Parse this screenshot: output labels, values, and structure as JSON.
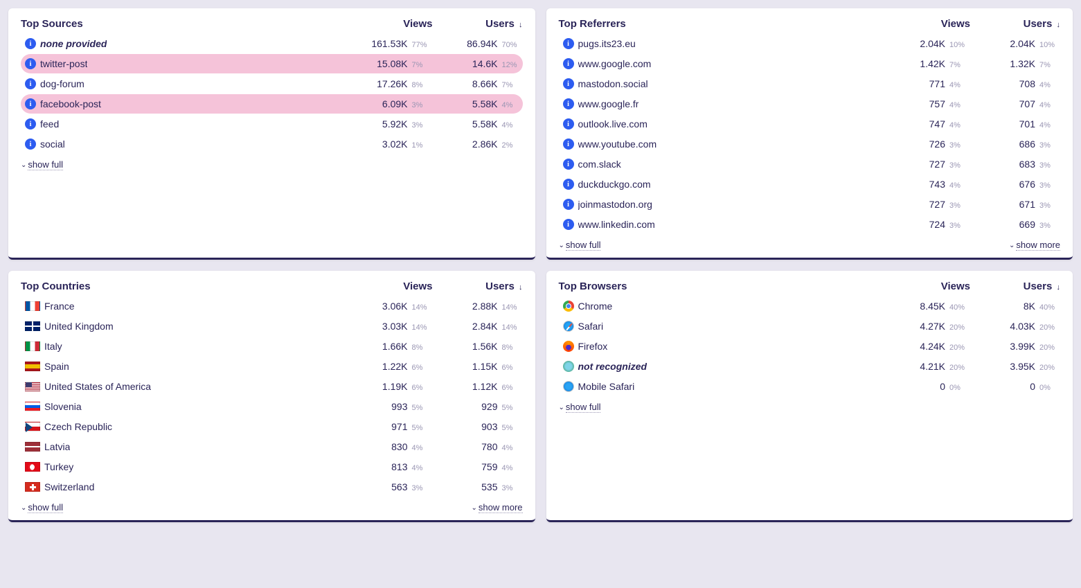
{
  "headers": {
    "views": "Views",
    "users": "Users",
    "sortIndicator": "↓"
  },
  "footer": {
    "showFull": "show full",
    "showMore": "show more"
  },
  "panels": {
    "sources": {
      "title": "Top Sources",
      "showMore": false,
      "rows": [
        {
          "label": "none provided",
          "italic": true,
          "highlight": false,
          "views": "161.53K",
          "viewsPct": "77%",
          "users": "86.94K",
          "usersPct": "70%"
        },
        {
          "label": "twitter-post",
          "italic": false,
          "highlight": true,
          "views": "15.08K",
          "viewsPct": "7%",
          "users": "14.6K",
          "usersPct": "12%"
        },
        {
          "label": "dog-forum",
          "italic": false,
          "highlight": false,
          "views": "17.26K",
          "viewsPct": "8%",
          "users": "8.66K",
          "usersPct": "7%"
        },
        {
          "label": "facebook-post",
          "italic": false,
          "highlight": true,
          "views": "6.09K",
          "viewsPct": "3%",
          "users": "5.58K",
          "usersPct": "4%"
        },
        {
          "label": "feed",
          "italic": false,
          "highlight": false,
          "views": "5.92K",
          "viewsPct": "3%",
          "users": "5.58K",
          "usersPct": "4%"
        },
        {
          "label": "social",
          "italic": false,
          "highlight": false,
          "views": "3.02K",
          "viewsPct": "1%",
          "users": "2.86K",
          "usersPct": "2%"
        }
      ]
    },
    "referrers": {
      "title": "Top Referrers",
      "showMore": true,
      "rows": [
        {
          "label": "pugs.its23.eu",
          "views": "2.04K",
          "viewsPct": "10%",
          "users": "2.04K",
          "usersPct": "10%"
        },
        {
          "label": "www.google.com",
          "views": "1.42K",
          "viewsPct": "7%",
          "users": "1.32K",
          "usersPct": "7%"
        },
        {
          "label": "mastodon.social",
          "views": "771",
          "viewsPct": "4%",
          "users": "708",
          "usersPct": "4%"
        },
        {
          "label": "www.google.fr",
          "views": "757",
          "viewsPct": "4%",
          "users": "707",
          "usersPct": "4%"
        },
        {
          "label": "outlook.live.com",
          "views": "747",
          "viewsPct": "4%",
          "users": "701",
          "usersPct": "4%"
        },
        {
          "label": "www.youtube.com",
          "views": "726",
          "viewsPct": "3%",
          "users": "686",
          "usersPct": "3%"
        },
        {
          "label": "com.slack",
          "views": "727",
          "viewsPct": "3%",
          "users": "683",
          "usersPct": "3%"
        },
        {
          "label": "duckduckgo.com",
          "views": "743",
          "viewsPct": "4%",
          "users": "676",
          "usersPct": "3%"
        },
        {
          "label": "joinmastodon.org",
          "views": "727",
          "viewsPct": "3%",
          "users": "671",
          "usersPct": "3%"
        },
        {
          "label": "www.linkedin.com",
          "views": "724",
          "viewsPct": "3%",
          "users": "669",
          "usersPct": "3%"
        }
      ]
    },
    "countries": {
      "title": "Top Countries",
      "showMore": true,
      "rows": [
        {
          "label": "France",
          "flag": "fr",
          "views": "3.06K",
          "viewsPct": "14%",
          "users": "2.88K",
          "usersPct": "14%"
        },
        {
          "label": "United Kingdom",
          "flag": "gb",
          "views": "3.03K",
          "viewsPct": "14%",
          "users": "2.84K",
          "usersPct": "14%"
        },
        {
          "label": "Italy",
          "flag": "it",
          "views": "1.66K",
          "viewsPct": "8%",
          "users": "1.56K",
          "usersPct": "8%"
        },
        {
          "label": "Spain",
          "flag": "es",
          "views": "1.22K",
          "viewsPct": "6%",
          "users": "1.15K",
          "usersPct": "6%"
        },
        {
          "label": "United States of America",
          "flag": "us",
          "views": "1.19K",
          "viewsPct": "6%",
          "users": "1.12K",
          "usersPct": "6%"
        },
        {
          "label": "Slovenia",
          "flag": "si",
          "views": "993",
          "viewsPct": "5%",
          "users": "929",
          "usersPct": "5%"
        },
        {
          "label": "Czech Republic",
          "flag": "cz",
          "views": "971",
          "viewsPct": "5%",
          "users": "903",
          "usersPct": "5%"
        },
        {
          "label": "Latvia",
          "flag": "lv",
          "views": "830",
          "viewsPct": "4%",
          "users": "780",
          "usersPct": "4%"
        },
        {
          "label": "Turkey",
          "flag": "tr",
          "views": "813",
          "viewsPct": "4%",
          "users": "759",
          "usersPct": "4%"
        },
        {
          "label": "Switzerland",
          "flag": "ch",
          "views": "563",
          "viewsPct": "3%",
          "users": "535",
          "usersPct": "3%"
        }
      ]
    },
    "browsers": {
      "title": "Top Browsers",
      "showMore": false,
      "rows": [
        {
          "label": "Chrome",
          "icon": "chrome",
          "views": "8.45K",
          "viewsPct": "40%",
          "users": "8K",
          "usersPct": "40%"
        },
        {
          "label": "Safari",
          "icon": "safari",
          "views": "4.27K",
          "viewsPct": "20%",
          "users": "4.03K",
          "usersPct": "20%"
        },
        {
          "label": "Firefox",
          "icon": "firefox",
          "views": "4.24K",
          "viewsPct": "20%",
          "users": "3.99K",
          "usersPct": "20%"
        },
        {
          "label": "not recognized",
          "icon": "unknown",
          "italic": true,
          "views": "4.21K",
          "viewsPct": "20%",
          "users": "3.95K",
          "usersPct": "20%"
        },
        {
          "label": "Mobile Safari",
          "icon": "msafari",
          "views": "0",
          "viewsPct": "0%",
          "users": "0",
          "usersPct": "0%"
        }
      ]
    }
  }
}
